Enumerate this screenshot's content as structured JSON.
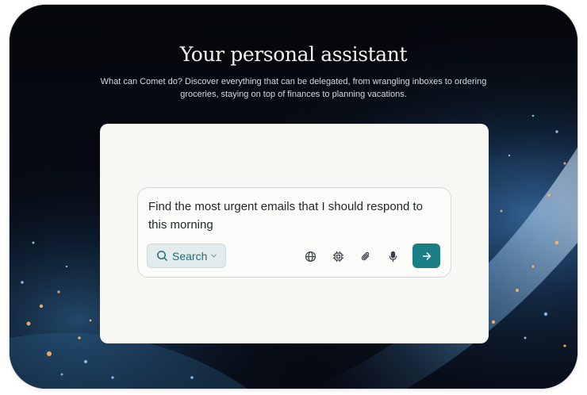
{
  "hero": {
    "title": "Your personal assistant",
    "subtitle": "What can Comet do? Discover everything that can be delegated, from wrangling inboxes to ordering groceries, staying on top of finances to planning vacations."
  },
  "composer": {
    "query": "Find the most urgent emails that I should respond to this morning",
    "mode_label": "Search",
    "mode_icon": "search-icon",
    "tools": [
      "globe-icon",
      "chip-icon",
      "paperclip-icon",
      "microphone-icon"
    ],
    "send_icon": "arrow-right-icon"
  },
  "colors": {
    "accent": "#1a7f85",
    "pill_bg": "#e2eced",
    "card_bg": "#f7f7f4",
    "background": "#05070c"
  }
}
